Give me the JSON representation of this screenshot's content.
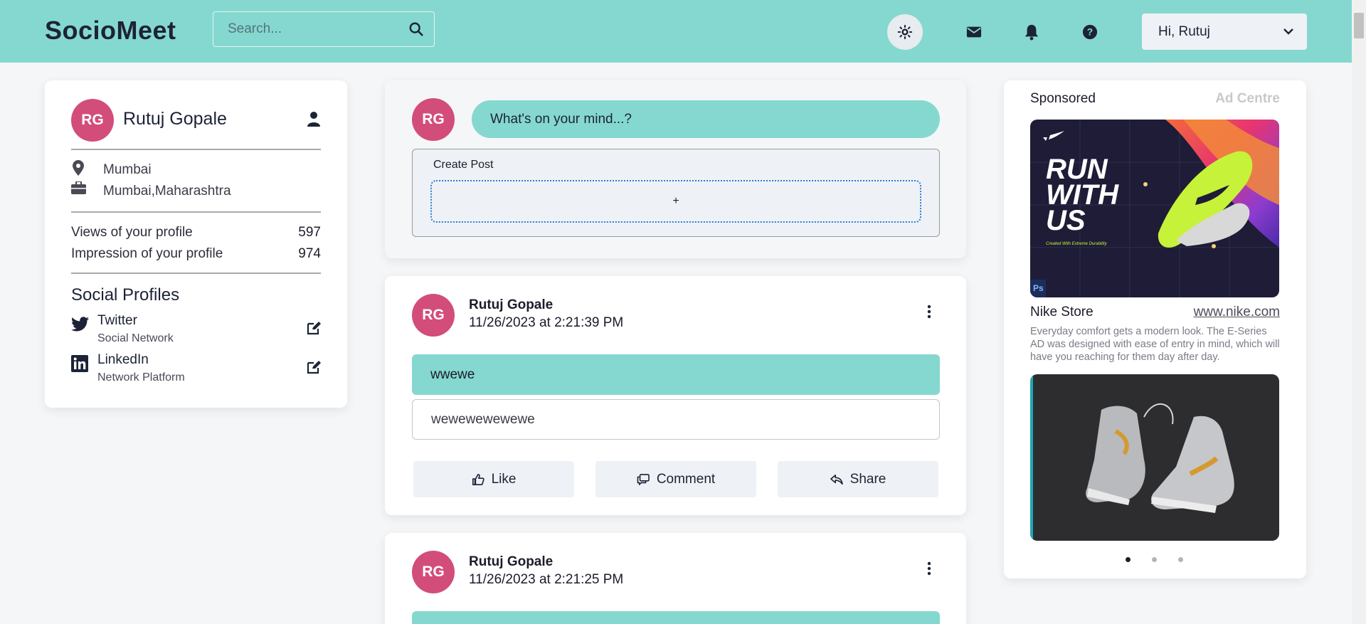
{
  "header": {
    "brand": "SocioMeet",
    "search_placeholder": "Search...",
    "user_greeting": "Hi, Rutuj"
  },
  "profile": {
    "initials": "RG",
    "name": "Rutuj Gopale",
    "location": "Mumbai",
    "work": "Mumbai,Maharashtra",
    "stats": [
      {
        "label": "Views of your profile",
        "value": "597"
      },
      {
        "label": "Impression of your profile",
        "value": "974"
      }
    ],
    "social_title": "Social Profiles",
    "socials": [
      {
        "name": "Twitter",
        "sub": "Social Network",
        "icon": "twitter-icon"
      },
      {
        "name": "LinkedIn",
        "sub": "Network Platform",
        "icon": "linkedin-icon"
      }
    ]
  },
  "composer": {
    "initials": "RG",
    "prompt": "What's on your mind...?",
    "create_label": "Create Post",
    "add_symbol": "+"
  },
  "posts": [
    {
      "initials": "RG",
      "author": "Rutuj Gopale",
      "time": "11/26/2023 at 2:21:39 PM",
      "title": "wwewe",
      "body": "wewewewewewe",
      "actions": {
        "like": "Like",
        "comment": "Comment",
        "share": "Share"
      }
    },
    {
      "initials": "RG",
      "author": "Rutuj Gopale",
      "time": "11/26/2023 at 2:21:25 PM"
    }
  ],
  "sponsored": {
    "title": "Sponsored",
    "ad_centre": "Ad Centre",
    "ad_text_lines": [
      "RUN",
      "WITH",
      "US"
    ],
    "ad_tagline": "Created With Extreme Durability",
    "ad_badge": "Ps",
    "store_name": "Nike Store",
    "store_link": "www.nike.com",
    "store_desc": "Everyday comfort gets a modern look. The E-Series AD was designed with ease of entry in mind, which will have you reaching for them day after day.",
    "carousel_active": 1,
    "carousel_count": 3
  },
  "colors": {
    "brand_teal": "#85d8cf",
    "avatar_pink": "#d24d7a",
    "page_bg": "#f4f6f8"
  }
}
